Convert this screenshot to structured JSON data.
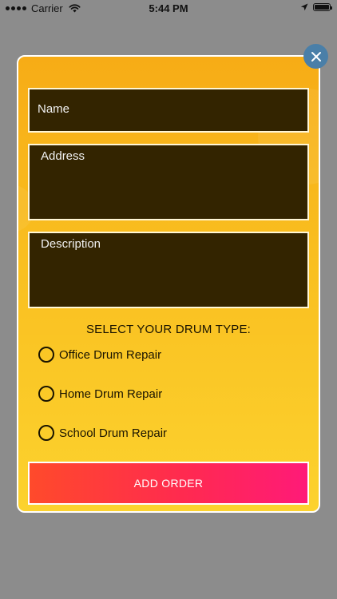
{
  "status_bar": {
    "carrier": "Carrier",
    "time": "5:44 PM",
    "icons": [
      "signal-dots",
      "wifi-icon",
      "location-arrow-icon",
      "battery-icon"
    ]
  },
  "modal": {
    "close_icon": "close-icon",
    "fields": {
      "name_placeholder": "Name",
      "address_placeholder": "Address",
      "description_placeholder": "Description"
    },
    "drum_type_title": "SELECT YOUR DRUM TYPE:",
    "drum_options": [
      {
        "label": "Office Drum Repair",
        "selected": false
      },
      {
        "label": "Home Drum Repair",
        "selected": false
      },
      {
        "label": "School Drum Repair",
        "selected": false
      }
    ],
    "submit_label": "ADD ORDER"
  },
  "colors": {
    "backdrop": "#8c8c8c",
    "modal_gradient_top": "#f7ac16",
    "modal_gradient_bottom": "#fcd22e",
    "field_bg": "#332400",
    "close_button": "#4a7fa8",
    "button_gradient_start": "#ff4a2b",
    "button_gradient_end": "#ff1a78"
  }
}
